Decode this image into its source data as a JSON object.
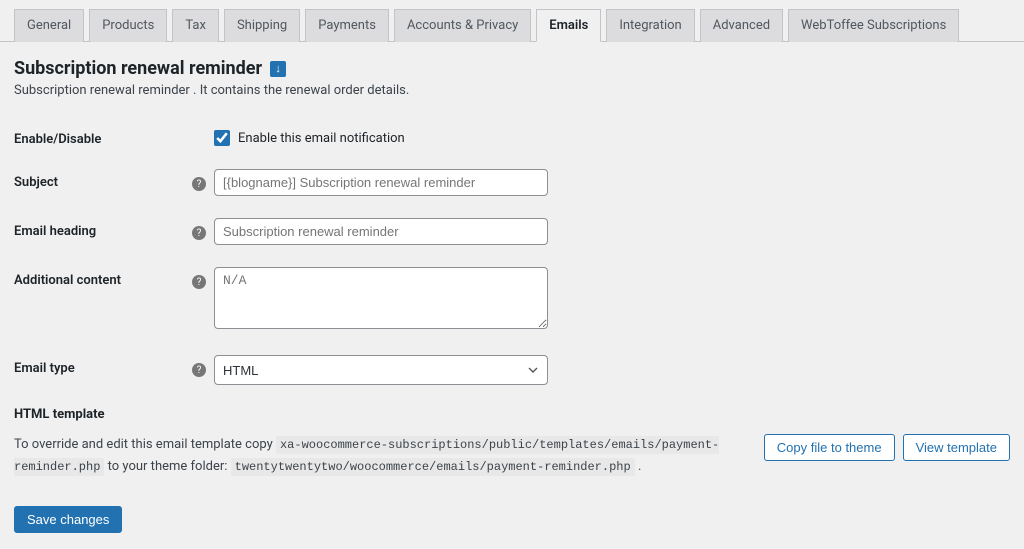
{
  "tabs": [
    {
      "label": "General"
    },
    {
      "label": "Products"
    },
    {
      "label": "Tax"
    },
    {
      "label": "Shipping"
    },
    {
      "label": "Payments"
    },
    {
      "label": "Accounts & Privacy"
    },
    {
      "label": "Emails",
      "active": true
    },
    {
      "label": "Integration"
    },
    {
      "label": "Advanced"
    },
    {
      "label": "WebToffee Subscriptions"
    }
  ],
  "page": {
    "title": "Subscription renewal reminder",
    "badge": "↓",
    "description": "Subscription renewal reminder . It contains the renewal order details."
  },
  "form": {
    "enable": {
      "label": "Enable/Disable",
      "checkbox_label": "Enable this email notification",
      "checked": true
    },
    "subject": {
      "label": "Subject",
      "placeholder": "[{blogname}] Subscription renewal reminder",
      "value": ""
    },
    "heading": {
      "label": "Email heading",
      "placeholder": "Subscription renewal reminder",
      "value": ""
    },
    "additional": {
      "label": "Additional content",
      "placeholder": "N/A",
      "value": ""
    },
    "email_type": {
      "label": "Email type",
      "value": "HTML"
    }
  },
  "template": {
    "heading": "HTML template",
    "text_before": "To override and edit this email template copy ",
    "code1": "xa-woocommerce-subscriptions/public/templates/emails/payment-reminder.php",
    "text_middle": " to your theme folder: ",
    "code2": "twentytwentytwo/woocommerce/emails/payment-reminder.php",
    "text_after": " .",
    "copy_btn": "Copy file to theme",
    "view_btn": "View template"
  },
  "save_btn": "Save changes"
}
